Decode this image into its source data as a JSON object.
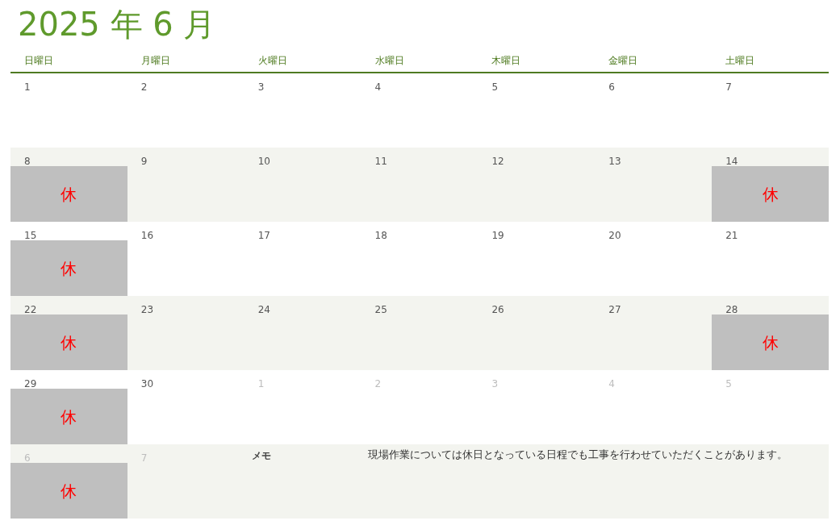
{
  "title": "2025 年 6 月",
  "weekdays": [
    "日曜日",
    "月曜日",
    "火曜日",
    "水曜日",
    "木曜日",
    "金曜日",
    "土曜日"
  ],
  "weeks": [
    {
      "days": [
        {
          "label": "1",
          "other_month": false
        },
        {
          "label": "2",
          "other_month": false
        },
        {
          "label": "3",
          "other_month": false
        },
        {
          "label": "4",
          "other_month": false
        },
        {
          "label": "5",
          "other_month": false
        },
        {
          "label": "6",
          "other_month": false
        },
        {
          "label": "7",
          "other_month": false
        }
      ]
    },
    {
      "days": [
        {
          "label": "8",
          "other_month": false,
          "mark": "休"
        },
        {
          "label": "9",
          "other_month": false
        },
        {
          "label": "10",
          "other_month": false
        },
        {
          "label": "11",
          "other_month": false
        },
        {
          "label": "12",
          "other_month": false
        },
        {
          "label": "13",
          "other_month": false
        },
        {
          "label": "14",
          "other_month": false,
          "mark": "休"
        }
      ]
    },
    {
      "days": [
        {
          "label": "15",
          "other_month": false,
          "mark": "休"
        },
        {
          "label": "16",
          "other_month": false
        },
        {
          "label": "17",
          "other_month": false
        },
        {
          "label": "18",
          "other_month": false
        },
        {
          "label": "19",
          "other_month": false
        },
        {
          "label": "20",
          "other_month": false
        },
        {
          "label": "21",
          "other_month": false
        }
      ]
    },
    {
      "days": [
        {
          "label": "22",
          "other_month": false,
          "mark": "休"
        },
        {
          "label": "23",
          "other_month": false
        },
        {
          "label": "24",
          "other_month": false
        },
        {
          "label": "25",
          "other_month": false
        },
        {
          "label": "26",
          "other_month": false
        },
        {
          "label": "27",
          "other_month": false
        },
        {
          "label": "28",
          "other_month": false,
          "mark": "休"
        }
      ]
    },
    {
      "days": [
        {
          "label": "29",
          "other_month": false,
          "mark": "休"
        },
        {
          "label": "30",
          "other_month": false
        },
        {
          "label": "1",
          "other_month": true
        },
        {
          "label": "2",
          "other_month": true
        },
        {
          "label": "3",
          "other_month": true
        },
        {
          "label": "4",
          "other_month": true
        },
        {
          "label": "5",
          "other_month": true
        }
      ]
    },
    {
      "days": [
        {
          "label": "6",
          "other_month": true,
          "mark": "休"
        },
        {
          "label": "7",
          "other_month": true
        }
      ]
    }
  ],
  "memo": {
    "label": "メモ",
    "text": "現場作業については休日となっている日程でも工事を行わせていただくことがあります。"
  }
}
